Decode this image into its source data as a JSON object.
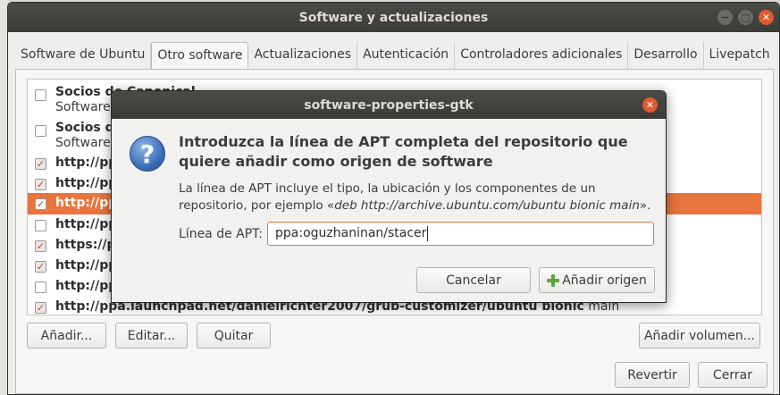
{
  "main_window": {
    "title": "Software y actualizaciones",
    "controls": [
      "−",
      "□",
      "✕"
    ],
    "tabs": [
      {
        "label": "Software de Ubuntu",
        "active": false
      },
      {
        "label": "Otro software",
        "active": true
      },
      {
        "label": "Actualizaciones",
        "active": false
      },
      {
        "label": "Autenticación",
        "active": false
      },
      {
        "label": "Controladores adicionales",
        "active": false
      },
      {
        "label": "Desarrollo",
        "active": false
      },
      {
        "label": "Livepatch",
        "active": false
      }
    ],
    "sources": [
      {
        "checked": false,
        "title": "Socios de Canonical",
        "subtitle": "Software e"
      },
      {
        "checked": false,
        "title": "Socios de C",
        "subtitle": "Software e"
      },
      {
        "checked": true,
        "title": "http://ppa",
        "subtitle": ""
      },
      {
        "checked": true,
        "title": "http://ppa",
        "subtitle": ""
      },
      {
        "checked": true,
        "title": "http://ppa",
        "subtitle": "",
        "selected": true
      },
      {
        "checked": false,
        "title": "http://ppa",
        "subtitle": ""
      },
      {
        "checked": true,
        "title": "https://pa",
        "subtitle": ""
      },
      {
        "checked": true,
        "title": "http://ppa",
        "subtitle": ""
      },
      {
        "checked": false,
        "title": "http://ppa",
        "subtitle": ""
      },
      {
        "checked": true,
        "title": "http://ppa.launchpad.net/danielrichter2007/grub-customizer/ubuntu bionic",
        "suffix": " main"
      }
    ],
    "buttons": {
      "add": "Añadir...",
      "edit": "Editar...",
      "remove": "Quitar",
      "add_volume": "Añadir volumen...",
      "revert": "Revertir",
      "close": "Cerrar"
    }
  },
  "dialog": {
    "title": "software-properties-gtk",
    "close": "✕",
    "icon_glyph": "?",
    "heading": "Introduzca la línea de APT completa del repositorio que quiere añadir como origen de software",
    "desc_prefix": "La línea de APT incluye el tipo, la ubicación y los componentes de un repositorio, por ejemplo «",
    "desc_example": "deb http://archive.ubuntu.com/ubuntu bionic main",
    "desc_suffix": "».",
    "apt_label": "Línea de APT:",
    "apt_value": "ppa:oguzhaninan/stacer",
    "cancel": "Cancelar",
    "add_source": "Añadir origen"
  },
  "colors": {
    "accent": "#e8753e",
    "titlebar": "#3b3b37",
    "close_button": "#e05a2f",
    "add_icon": "#5fa83c"
  }
}
